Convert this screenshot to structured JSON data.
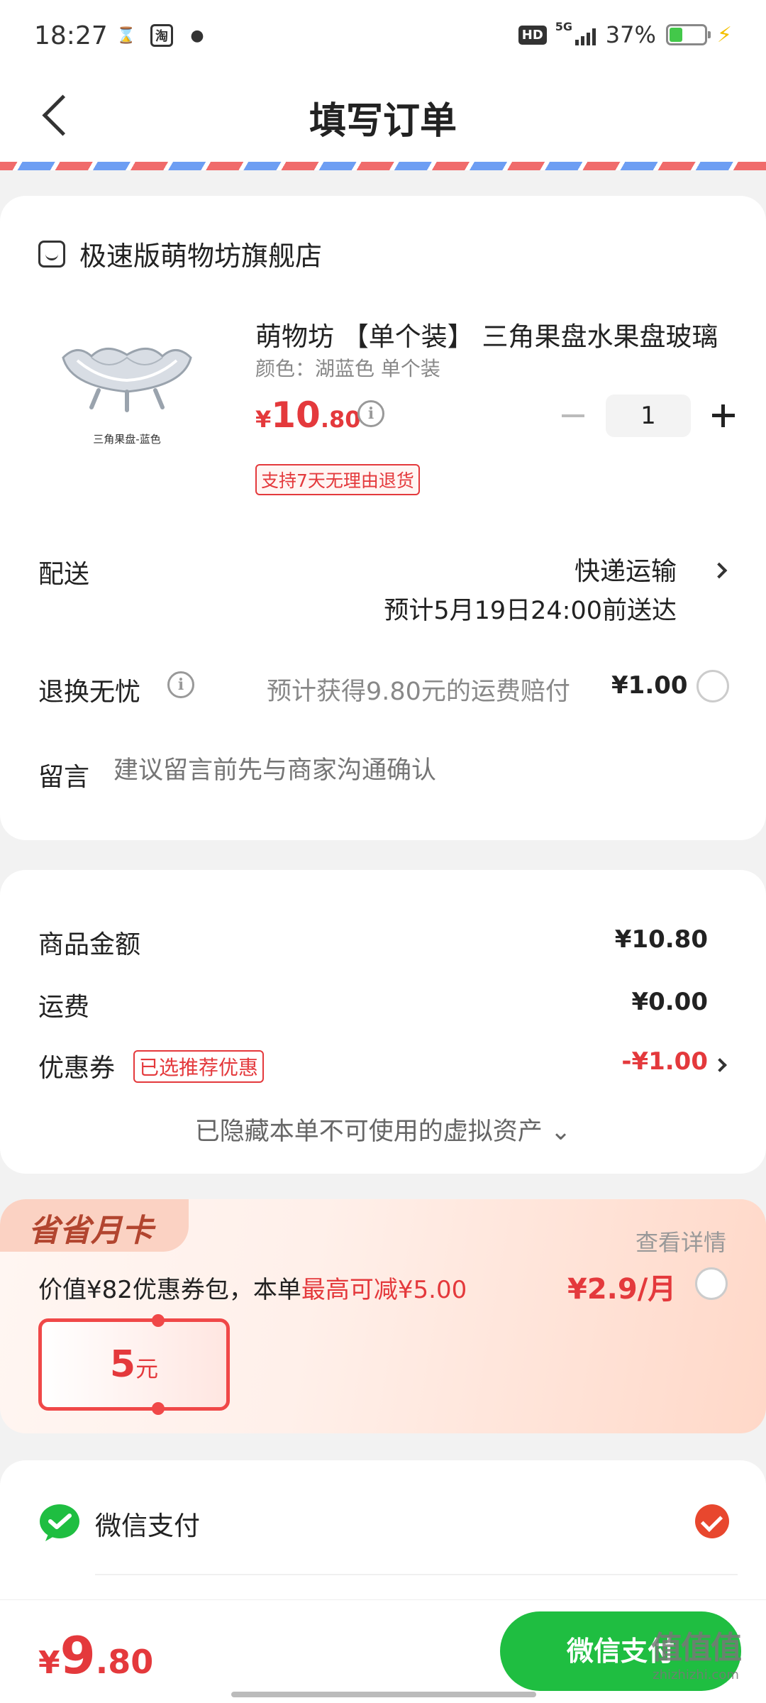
{
  "status_bar": {
    "time": "18:27",
    "network": "5G",
    "hd": "HD",
    "battery": "37%",
    "battery_level": 0.37,
    "icons": [
      "hourglass-icon",
      "taobao-icon",
      "message-icon"
    ]
  },
  "header": {
    "title": "填写订单"
  },
  "store": {
    "name": "极速版萌物坊旗舰店",
    "product": {
      "title": "萌物坊 【单个装】 三角果盘水果盘玻璃",
      "sku": "颜色：湖蓝色 单个装",
      "image_caption": "三角果盘-蓝色",
      "price_yen": "¥",
      "price_int": "10",
      "price_dec": ".80",
      "quantity": "1",
      "return_badge": "支持7天无理由退货"
    },
    "delivery": {
      "label": "配送",
      "method": "快递运输",
      "eta": "预计5月19日24:00前送达"
    },
    "worry_free": {
      "label": "退换无忧",
      "desc": "预计获得9.80元的运费赔付",
      "price": "¥1.00"
    },
    "message": {
      "label": "留言",
      "placeholder": "建议留言前先与商家沟通确认"
    }
  },
  "summary": {
    "goods_label": "商品金额",
    "goods_value": "¥10.80",
    "shipping_label": "运费",
    "shipping_value": "¥0.00",
    "coupon_label": "优惠券",
    "coupon_badge": "已选推荐优惠",
    "coupon_value": "-¥1.00",
    "hidden_note": "已隐藏本单不可使用的虚拟资产 ⌄"
  },
  "monthly_card": {
    "tag": "省省月卡",
    "detail_link": "查看详情",
    "desc_prefix": "价值¥82优惠券包，本单",
    "desc_highlight": "最高可减¥5.00",
    "price": "¥2.9/月",
    "voucher_amount": "5",
    "voucher_unit": "元"
  },
  "payment": {
    "method": "微信支付",
    "selected": true
  },
  "bottom_bar": {
    "total_yen": "¥",
    "total_int": "9",
    "total_dec": ".80",
    "pay_button": "微信支付"
  },
  "watermark": {
    "logo": "值值值",
    "site": "zhizhizhi.com"
  },
  "colors": {
    "accent_red": "#e4393c",
    "wechat_green": "#1fbe41",
    "check_orange": "#e8472e"
  }
}
